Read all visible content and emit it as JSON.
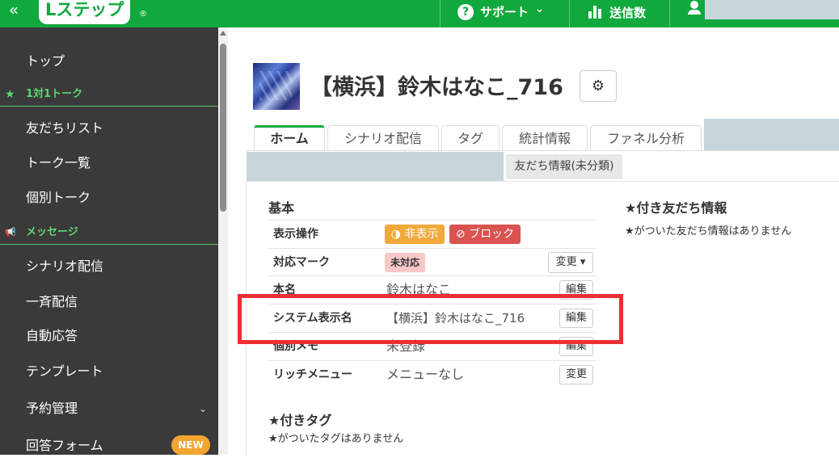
{
  "topbar": {
    "collapse_glyph": "«",
    "logo_text": "Lステップ",
    "logo_reg": "®",
    "support_label": "サポート",
    "support_glyph": "?",
    "send_count_label": "送信数",
    "dropdown_glyph": "⌄"
  },
  "sidebar": {
    "items": [
      {
        "label": "トップ"
      },
      {
        "label": "1対1トーク",
        "section": true
      },
      {
        "label": "友だちリスト"
      },
      {
        "label": "トーク一覧"
      },
      {
        "label": "個別トーク"
      },
      {
        "label": "メッセージ",
        "section": true
      },
      {
        "label": "シナリオ配信"
      },
      {
        "label": "一斉配信"
      },
      {
        "label": "自動応答"
      },
      {
        "label": "テンプレート"
      },
      {
        "label": "予約管理"
      },
      {
        "label": "回答フォーム"
      }
    ],
    "new_badge": "NEW",
    "star_glyph": "★",
    "megaphone_glyph": "📢",
    "chevron_glyph": "⌄"
  },
  "header": {
    "title": "【横浜】鈴木はなこ_716",
    "settings_glyph": "⚙"
  },
  "tabs": [
    {
      "label": "ホーム",
      "active": true
    },
    {
      "label": "シナリオ配信"
    },
    {
      "label": "タグ"
    },
    {
      "label": "統計情報"
    },
    {
      "label": "ファネル分析"
    }
  ],
  "subtab": {
    "label": "友だち情報(未分類)"
  },
  "basic": {
    "title": "基本",
    "rows": [
      {
        "label": "表示操作"
      },
      {
        "label": "対応マーク"
      },
      {
        "label": "本名",
        "value": "鈴木はなこ",
        "button": "編集"
      },
      {
        "label": "システム表示名",
        "value": "【横浜】鈴木はなこ_716",
        "button": "編集"
      },
      {
        "label": "個別メモ",
        "value": "未登録",
        "button": "編集"
      },
      {
        "label": "リッチメニュー",
        "value": "メニューなし",
        "button": "変更"
      }
    ],
    "hide_button": "非表示",
    "block_button": "ブロック",
    "mark_badge": "未対応",
    "mark_change_button": "変更",
    "hide_icon_glyph": "◑",
    "block_icon_glyph": "⊘"
  },
  "friend_info": {
    "title": "★付き友だち情報",
    "empty_text": "★がついた友だち情報はありません"
  },
  "tags_section": {
    "title": "★付きタグ",
    "empty_text": "★がついたタグはありません"
  },
  "colors": {
    "brand_green": "#11a83d",
    "sidebar_bg": "#3a3a3a",
    "highlight_red": "#ee2e35",
    "hide_orange": "#f0a93a",
    "block_red": "#d9534f"
  }
}
